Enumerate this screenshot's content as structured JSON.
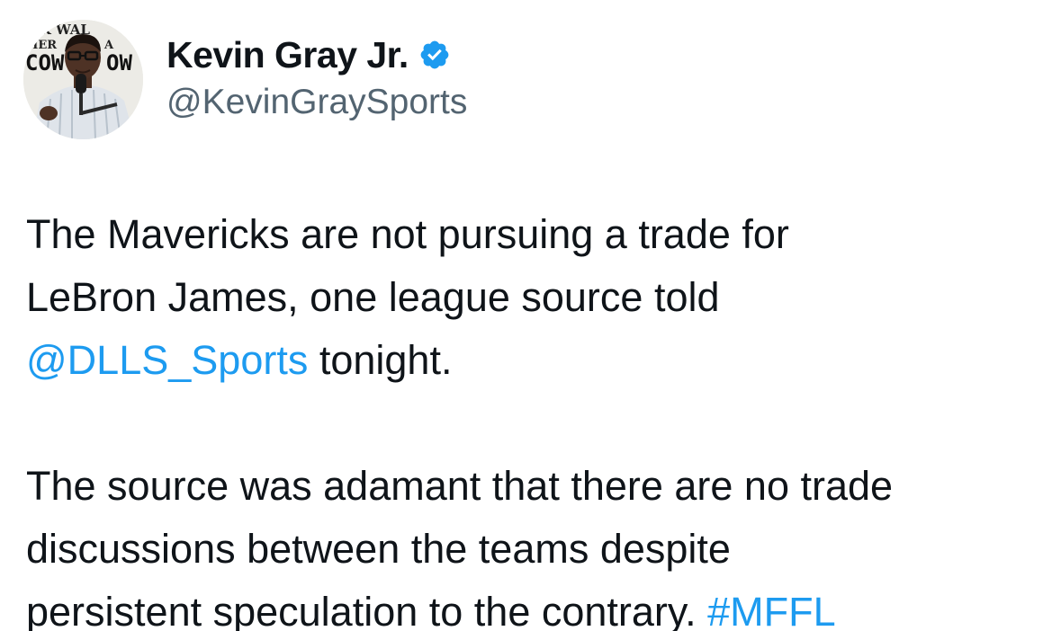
{
  "author": {
    "display_name": "Kevin Gray Jr.",
    "handle": "@KevinGraySports",
    "verified_icon": "verified-badge-icon",
    "avatar_sign_text": [
      "AK WAL",
      "MER",
      "A",
      "COW",
      "OW"
    ]
  },
  "tweet": {
    "para1_text1": "The Mavericks are not pursuing a trade for",
    "para1_text2": "LeBron James, one league source told",
    "mention": "@DLLS_Sports",
    "para1_text3": " tonight.",
    "para2_text1": "The source was adamant that there are no trade",
    "para2_text2": "discussions between the teams despite",
    "para2_text3": "persistent speculation to the contrary. ",
    "hashtag": "#MFFL"
  },
  "colors": {
    "link": "#1d9bf0",
    "verified": "#1d9bf0",
    "text": "#0f1419",
    "secondary": "#536471"
  }
}
